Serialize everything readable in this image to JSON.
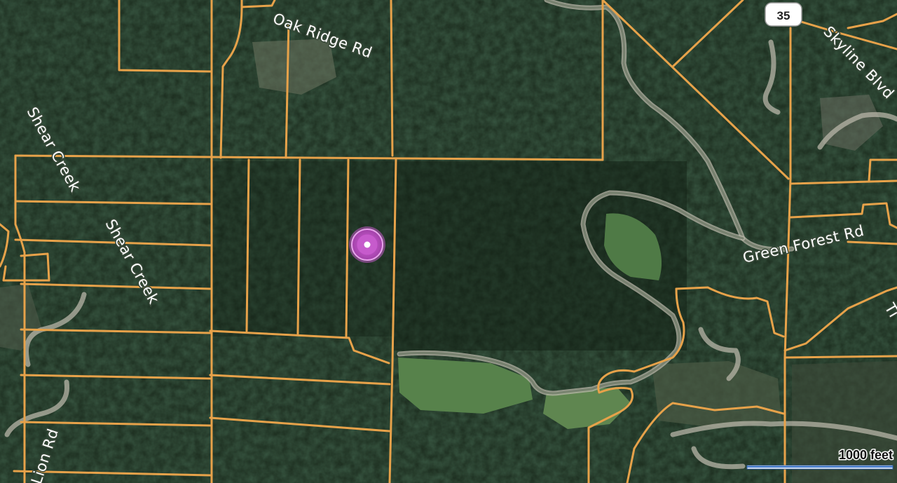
{
  "map": {
    "road_labels": {
      "oak_ridge": "Oak Ridge Rd",
      "shear_creek_1": "Shear Creek",
      "shear_creek_2": "Shear Creek",
      "green_forest": "Green Forest Rd",
      "skyline": "Skyline Blvd",
      "lion": "Lion Rd",
      "partial_t": "Ti"
    },
    "highway_shield": "35",
    "scale_bar": {
      "label": "1000 feet"
    },
    "colors": {
      "parcel_line": "#e7a24a",
      "forest_dark": "#17261a",
      "meadow": "#4f7a46",
      "pin_outer": "#b04fb8",
      "pin_inner": "#ffffff",
      "highway_shield_bg": "#ffffff"
    },
    "marker": {
      "icon": "location-pin-icon"
    }
  }
}
